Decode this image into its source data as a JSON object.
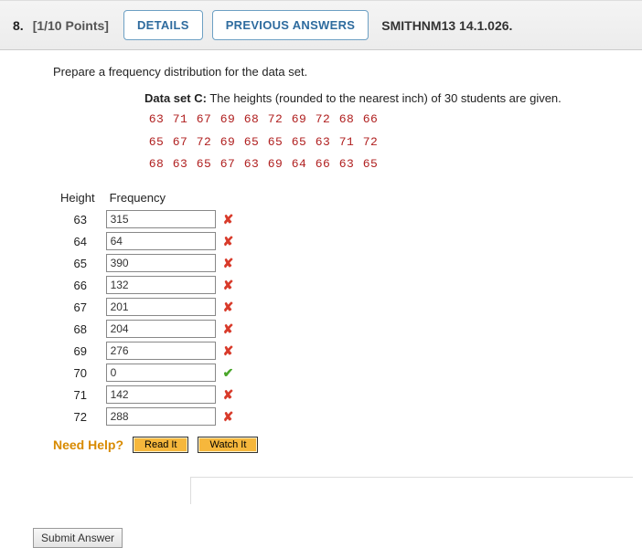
{
  "header": {
    "number": "8.",
    "points": "[1/10 Points]",
    "details_label": "DETAILS",
    "previous_label": "PREVIOUS ANSWERS",
    "source_ref": "SMITHNM13 14.1.026."
  },
  "prompt": "Prepare a frequency distribution for the data set.",
  "dataset": {
    "label": "Data set C:",
    "desc": "The heights (rounded to the nearest inch) of 30 students are given.",
    "rows": [
      [
        "63",
        "71",
        "67",
        "69",
        "68",
        "72",
        "69",
        "72",
        "68",
        "66"
      ],
      [
        "65",
        "67",
        "72",
        "69",
        "65",
        "65",
        "65",
        "63",
        "71",
        "72"
      ],
      [
        "68",
        "63",
        "65",
        "67",
        "63",
        "69",
        "64",
        "66",
        "63",
        "65"
      ]
    ]
  },
  "table": {
    "col_height": "Height",
    "col_freq": "Frequency",
    "rows": [
      {
        "height": "63",
        "value": "315",
        "mark": "✘",
        "ok": false
      },
      {
        "height": "64",
        "value": "64",
        "mark": "✘",
        "ok": false
      },
      {
        "height": "65",
        "value": "390",
        "mark": "✘",
        "ok": false
      },
      {
        "height": "66",
        "value": "132",
        "mark": "✘",
        "ok": false
      },
      {
        "height": "67",
        "value": "201",
        "mark": "✘",
        "ok": false
      },
      {
        "height": "68",
        "value": "204",
        "mark": "✘",
        "ok": false
      },
      {
        "height": "69",
        "value": "276",
        "mark": "✘",
        "ok": false
      },
      {
        "height": "70",
        "value": "0",
        "mark": "✔",
        "ok": true
      },
      {
        "height": "71",
        "value": "142",
        "mark": "✘",
        "ok": false
      },
      {
        "height": "72",
        "value": "288",
        "mark": "✘",
        "ok": false
      }
    ]
  },
  "help": {
    "label": "Need Help?",
    "read": "Read It",
    "watch": "Watch It"
  },
  "submit_label": "Submit Answer"
}
